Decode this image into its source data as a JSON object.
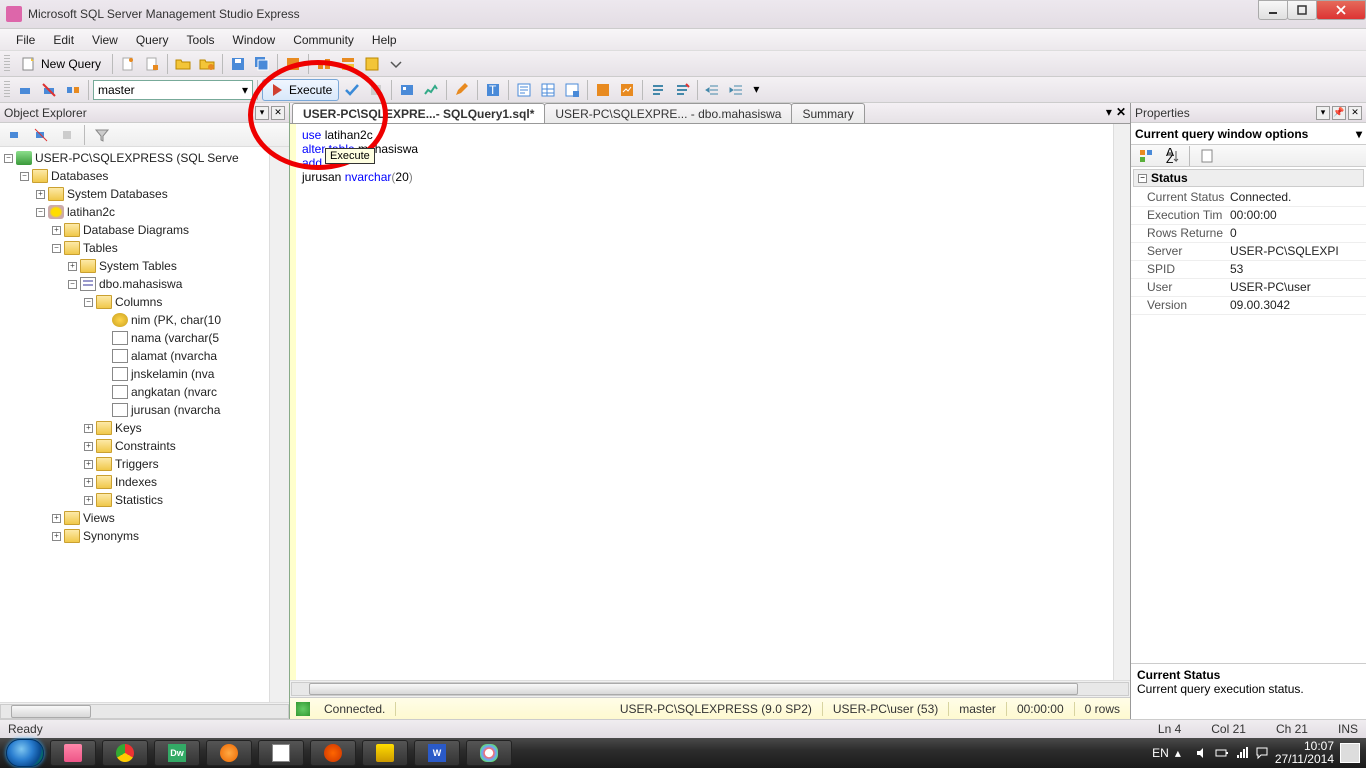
{
  "window": {
    "title": "Microsoft SQL Server Management Studio Express"
  },
  "menu": {
    "file": "File",
    "edit": "Edit",
    "view": "View",
    "query": "Query",
    "tools": "Tools",
    "window": "Window",
    "community": "Community",
    "help": "Help"
  },
  "toolbar": {
    "new_query": "New Query",
    "db_selected": "master",
    "execute": "Execute",
    "execute_tooltip": "Execute"
  },
  "object_explorer": {
    "title": "Object Explorer",
    "server": "USER-PC\\SQLEXPRESS (SQL Serve",
    "nodes": {
      "databases": "Databases",
      "system_databases": "System Databases",
      "db": "latihan2c",
      "database_diagrams": "Database Diagrams",
      "tables": "Tables",
      "system_tables": "System Tables",
      "table": "dbo.mahasiswa",
      "columns": "Columns",
      "col_nim": "nim (PK, char(10",
      "col_nama": "nama (varchar(5",
      "col_alamat": "alamat (nvarcha",
      "col_jnskelamin": "jnskelamin (nva",
      "col_angkatan": "angkatan (nvarc",
      "col_jurusan": "jurusan (nvarcha",
      "keys": "Keys",
      "constraints": "Constraints",
      "triggers": "Triggers",
      "indexes": "Indexes",
      "statistics": "Statistics",
      "views": "Views",
      "synonyms": "Synonyms"
    }
  },
  "tabs": {
    "t1": "USER-PC\\SQLEXPRE...- SQLQuery1.sql*",
    "t2": "USER-PC\\SQLEXPRE... - dbo.mahasiswa",
    "t3": "Summary"
  },
  "code": {
    "l1_a": "use",
    "l1_b": " latihan2c",
    "l2_a": "alter",
    "l2_b": " table",
    "l2_c": " mahasiswa",
    "l3": "add",
    "l4_a": "jurusan ",
    "l4_b": "nvarchar",
    "l4_c": "(",
    "l4_d": "20",
    "l4_e": ")"
  },
  "editor_status": {
    "connected": "Connected.",
    "server": "USER-PC\\SQLEXPRESS (9.0 SP2)",
    "user": "USER-PC\\user (53)",
    "db": "master",
    "time": "00:00:00",
    "rows": "0 rows"
  },
  "properties": {
    "title": "Properties",
    "selector": "Current query window options",
    "cat_status": "Status",
    "rows": {
      "current_status_k": "Current Status",
      "current_status_v": "Connected.",
      "exec_time_k": "Execution Tim",
      "exec_time_v": "00:00:00",
      "rows_ret_k": "Rows Returne",
      "rows_ret_v": "0",
      "server_k": "Server",
      "server_v": "USER-PC\\SQLEXPI",
      "spid_k": "SPID",
      "spid_v": "53",
      "user_k": "User",
      "user_v": "USER-PC\\user",
      "version_k": "Version",
      "version_v": "09.00.3042"
    },
    "desc_title": "Current Status",
    "desc_body": "Current query execution status."
  },
  "app_status": {
    "ready": "Ready",
    "ln": "Ln 4",
    "col": "Col 21",
    "ch": "Ch 21",
    "ins": "INS"
  },
  "taskbar": {
    "lang": "EN",
    "time": "10:07",
    "date": "27/11/2014"
  }
}
